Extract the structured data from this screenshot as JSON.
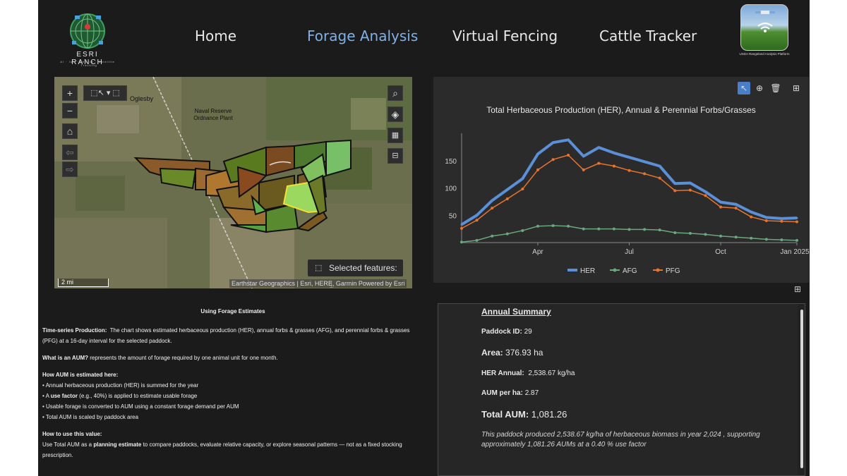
{
  "header": {
    "logo_text": "ESRI RANCH",
    "logo_sub": "AI · IoT · Remote · Satellite · Tracking",
    "nav": [
      {
        "label": "Home",
        "active": false
      },
      {
        "label": "Forage Analysis",
        "active": true
      },
      {
        "label": "Virtual Fencing",
        "active": false
      },
      {
        "label": "Cattle Tracker",
        "active": false
      }
    ],
    "usda_sub": "USDA Rangeland Analysis Platform"
  },
  "map": {
    "place_ogl": "Oglesby",
    "place_naval": "Naval Reserve Ordnance Plant",
    "selected_label": "Selected features: 1",
    "scale": "2 mi",
    "attribution": "Earthstar Geographics | Esri, HERE, Garmin   Powered by Esri",
    "tools": [
      "zoom-in-icon",
      "zoom-out-icon",
      "home-icon",
      "back-icon",
      "forward-icon",
      "select-icon",
      "search-icon",
      "layers-icon",
      "qr-icon",
      "measure-icon"
    ]
  },
  "chart_data": {
    "type": "line",
    "title": "Total Herbaceous Production (HER), Annual & Perennial Forbs/Grasses",
    "x_ticks": [
      "Apr",
      "Jul",
      "Oct",
      "Jan 2025"
    ],
    "y_ticks": [
      50,
      100,
      150
    ],
    "ylim": [
      0,
      200
    ],
    "legend": [
      "HER",
      "AFG",
      "PFG"
    ],
    "legend_position": "bottom",
    "grid": false,
    "series": [
      {
        "name": "HER",
        "color": "#5b8fd6",
        "values": [
          33,
          50,
          77,
          97,
          117,
          162,
          183,
          188,
          158,
          174,
          164,
          156,
          148,
          140,
          108,
          109,
          93,
          74,
          70,
          56,
          46,
          44,
          45
        ]
      },
      {
        "name": "AFG",
        "color": "#6aa87f",
        "values": [
          1,
          4,
          12,
          16,
          22,
          30,
          31,
          30,
          25,
          25,
          25,
          24,
          24,
          23,
          18,
          17,
          15,
          12,
          10,
          8,
          6,
          5,
          4
        ]
      },
      {
        "name": "PFG",
        "color": "#e8742e",
        "values": [
          26,
          41,
          63,
          80,
          98,
          133,
          152,
          160,
          133,
          145,
          140,
          132,
          126,
          118,
          95,
          96,
          86,
          65,
          63,
          47,
          40,
          39,
          38
        ]
      }
    ]
  },
  "info": {
    "title": "Using Forage Estimates",
    "ts_label": "Time-series Production:",
    "ts_text": "The chart shows estimated herbaceous production (HER), annual forbs & grasses (AFG), and perennial forbs & grasses (PFG) at a 16-day interval for the selected paddock.",
    "aum_label": "What is an AUM?",
    "aum_text": " represents the amount of forage required by one animal unit for one month.",
    "how_label": "How AUM is estimated here:",
    "how_items": [
      "• Annual herbaceous production (HER) is summed for the year",
      "• Usable forage is converted to AUM using a constant forage demand per AUM",
      "• Total AUM is scaled by paddock area"
    ],
    "use_factor_pre": "• A ",
    "use_factor_bold": "use factor",
    "use_factor_post": " (e.g., 40%) is applied to estimate usable forage",
    "use_label": "How to use this value:",
    "use_pre": "Use Total AUM as a ",
    "use_bold": "planning estimate",
    "use_post": " to compare paddocks, evaluate relative capacity, or explore seasonal patterns — not as a fixed stocking prescription."
  },
  "summary": {
    "title": "Annual Summary",
    "paddock_label": "Paddock ID:",
    "paddock_value": "29",
    "area_label": "Area:",
    "area_value": "376.93 ha",
    "her_label": "HER Annual:",
    "her_value": "2,538.67 kg/ha",
    "aum_ha_label": "AUM per ha:",
    "aum_ha_value": "2.87",
    "total_label": "Total AUM:",
    "total_value": "1,081.26",
    "note": "This paddock produced 2,538.67 kg/ha of herbaceous biomass in year  2,024 , supporting approximately 1,081.26 AUMs at a 0.40 % use factor"
  }
}
